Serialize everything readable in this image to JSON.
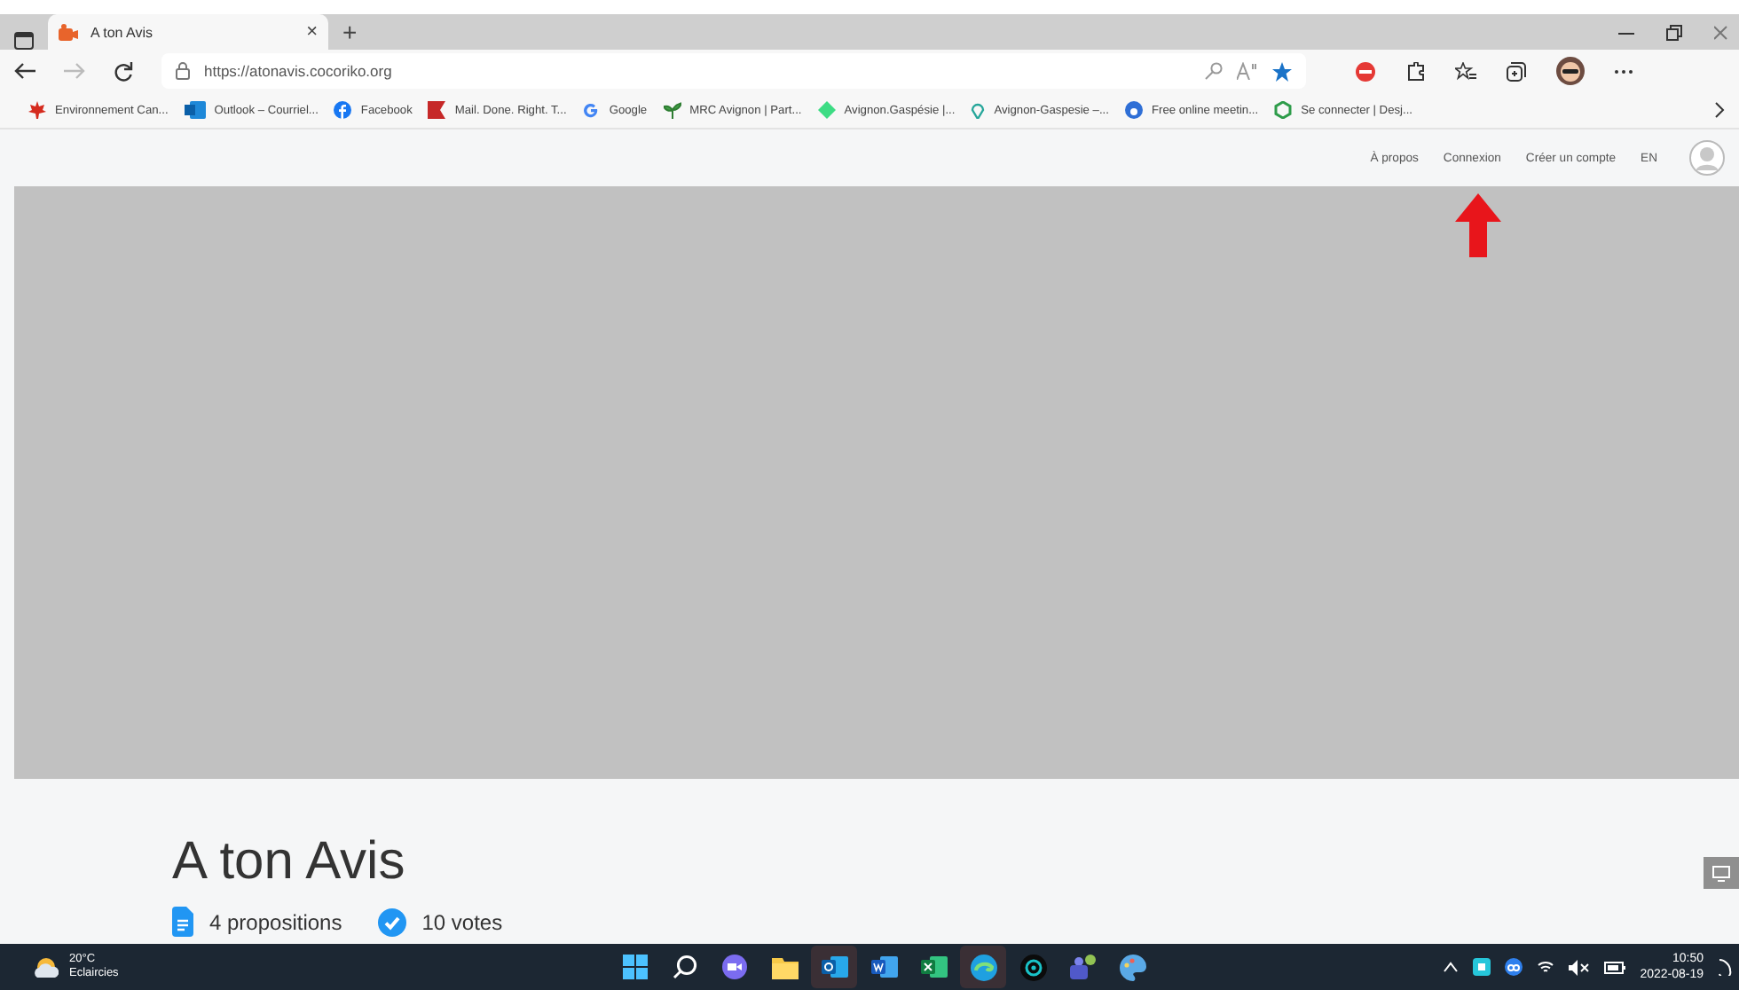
{
  "browser": {
    "tab": {
      "title": "A ton Avis",
      "close": "×",
      "new_tab": "+"
    },
    "address": "https://atonavis.cocoriko.org",
    "bookmarks": [
      {
        "kind": "leaf",
        "label": "Environnement Can..."
      },
      {
        "kind": "outlook",
        "label": "Outlook – Courriel..."
      },
      {
        "kind": "facebook",
        "label": "Facebook"
      },
      {
        "kind": "flag",
        "label": "Mail. Done. Right. T..."
      },
      {
        "kind": "google",
        "label": "Google"
      },
      {
        "kind": "sprout",
        "label": "MRC Avignon | Part..."
      },
      {
        "kind": "diamond",
        "label": "Avignon.Gaspésie |..."
      },
      {
        "kind": "pin",
        "label": "Avignon-Gaspesie –..."
      },
      {
        "kind": "disc",
        "label": "Free online meetin..."
      },
      {
        "kind": "ring",
        "label": "Se connecter | Desj..."
      }
    ]
  },
  "site_nav": {
    "links": [
      "À propos",
      "Connexion",
      "Créer un compte",
      "EN"
    ]
  },
  "project": {
    "title": "A ton Avis",
    "stats": [
      {
        "kind": "document",
        "text": "4 propositions"
      },
      {
        "kind": "check",
        "text": "10 votes"
      }
    ]
  },
  "taskbar": {
    "weather": {
      "temp": "20°C",
      "condition": "Eclaircies"
    },
    "apps": [
      {
        "kind": "start",
        "active": false
      },
      {
        "kind": "search",
        "active": false
      },
      {
        "kind": "video",
        "active": false
      },
      {
        "kind": "folder",
        "active": false
      },
      {
        "kind": "outlook",
        "active": true
      },
      {
        "kind": "word",
        "active": false
      },
      {
        "kind": "excel",
        "active": false
      },
      {
        "kind": "edge",
        "active": true
      },
      {
        "kind": "target",
        "active": false
      },
      {
        "kind": "teams",
        "active": false
      },
      {
        "kind": "paint",
        "active": false
      }
    ],
    "time": "10:50",
    "date": "2022-08-19"
  }
}
